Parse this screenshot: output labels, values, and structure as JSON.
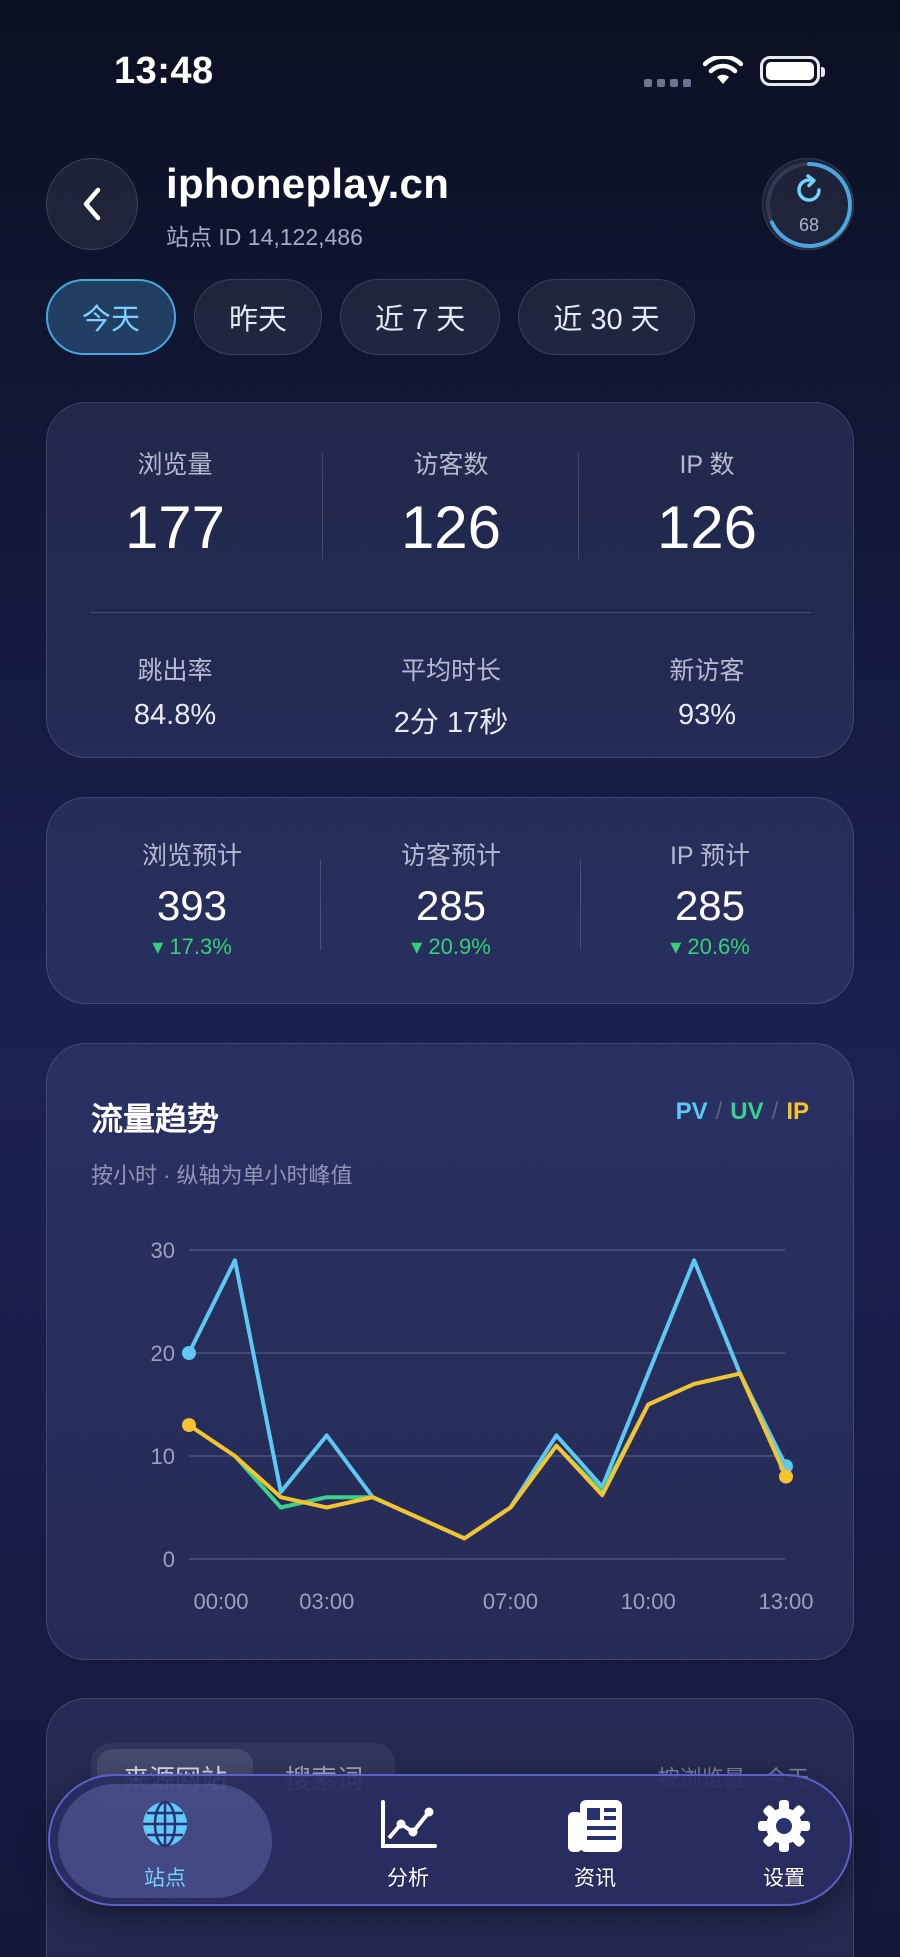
{
  "status_bar": {
    "time": "13:48"
  },
  "header": {
    "site_title": "iphoneplay.cn",
    "site_id": "站点 ID 14,122,486",
    "refresh_count": "68"
  },
  "range_tabs": [
    {
      "label": "今天",
      "active": true
    },
    {
      "label": "昨天",
      "active": false
    },
    {
      "label": "近 7 天",
      "active": false
    },
    {
      "label": "近 30 天",
      "active": false
    }
  ],
  "summary": {
    "pv_label": "浏览量",
    "pv_value": "177",
    "uv_label": "访客数",
    "uv_value": "126",
    "ip_label": "IP 数",
    "ip_value": "126",
    "bounce_label": "跳出率",
    "bounce_value": "84.8%",
    "duration_label": "平均时长",
    "duration_value": "2分 17秒",
    "new_label": "新访客",
    "new_value": "93%"
  },
  "projection": {
    "pv_label": "浏览预计",
    "pv_value": "393",
    "pv_delta": "▾ 17.3%",
    "uv_label": "访客预计",
    "uv_value": "285",
    "uv_delta": "▾ 20.9%",
    "ip_label": "IP 预计",
    "ip_value": "285",
    "ip_delta": "▾ 20.6%"
  },
  "trend": {
    "title": "流量趋势",
    "subtitle": "按小时 · 纵轴为单小时峰值",
    "legend_pv": "PV",
    "legend_uv": "UV",
    "legend_ip": "IP",
    "colors": {
      "pv": "#5ec8f2",
      "uv": "#3ccf8e",
      "ip": "#f5c32e"
    }
  },
  "chart_data": {
    "type": "line",
    "x": [
      0,
      1,
      2,
      3,
      4,
      5,
      6,
      7,
      8,
      9,
      10,
      11,
      12,
      13
    ],
    "x_tick_labels": [
      "00:00",
      "03:00",
      "07:00",
      "10:00",
      "13:00"
    ],
    "x_tick_positions": [
      0,
      3,
      7,
      10,
      13
    ],
    "ylim": [
      0,
      30
    ],
    "y_ticks": [
      0,
      10,
      20,
      30
    ],
    "grid": true,
    "series": [
      {
        "name": "PV",
        "values": [
          20,
          29,
          6.5,
          12,
          6,
          4,
          2,
          5,
          12,
          7,
          18,
          29,
          18,
          9
        ]
      },
      {
        "name": "UV",
        "values": [
          13,
          10,
          5,
          6,
          6,
          4,
          2,
          5,
          11,
          6.5,
          15,
          17,
          18,
          8
        ]
      },
      {
        "name": "IP",
        "values": [
          13,
          10,
          6,
          5,
          6,
          4,
          2,
          5,
          11,
          6.2,
          15,
          17,
          18,
          8
        ]
      }
    ]
  },
  "sources": {
    "tab_sites": "来源网站",
    "tab_keywords": "搜索词",
    "right_hint": "按浏览量 · 今天"
  },
  "bottom_nav": [
    {
      "label": "站点",
      "icon": "globe-icon",
      "active": true
    },
    {
      "label": "分析",
      "icon": "chart-icon",
      "active": false
    },
    {
      "label": "资讯",
      "icon": "news-icon",
      "active": false
    },
    {
      "label": "设置",
      "icon": "gear-icon",
      "active": false
    }
  ]
}
